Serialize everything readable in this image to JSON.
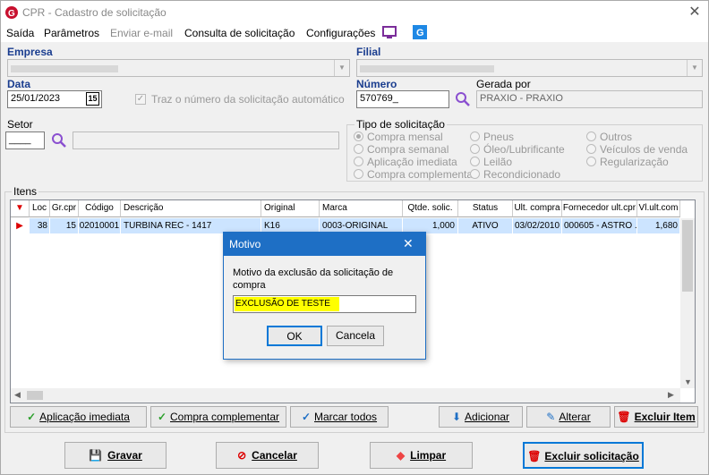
{
  "window": {
    "title": "CPR - Cadastro de solicitação",
    "close": "✕"
  },
  "menu": {
    "saida": "Saída",
    "parametros": "Parâmetros",
    "enviar": "Enviar e-mail",
    "consulta": "Consulta de solicitação",
    "configuracoes": "Configurações"
  },
  "form": {
    "empresa_label": "Empresa",
    "filial_label": "Filial",
    "data_label": "Data",
    "data_value": "25/01/2023",
    "cal_day": "15",
    "traz_label": "Traz o número da solicitação automático",
    "numero_label": "Número",
    "numero_value": "570769_",
    "gerada_label": "Gerada por",
    "gerada_value": "PRAXIO - PRAXIO",
    "setor_label": "Setor",
    "setor_value": "____"
  },
  "tipo": {
    "title": "Tipo de solicitação",
    "options": [
      "Compra mensal",
      "Compra semanal",
      "Aplicação imediata",
      "Compra complementar",
      "Pneus",
      "Óleo/Lubrificante",
      "Leilão",
      "Recondicionado",
      "Outros",
      "Veículos de venda",
      "Regularização"
    ]
  },
  "itens": {
    "title": "Itens",
    "columns": [
      "Loc",
      "Gr.cpr",
      "Código",
      "Descrição",
      "Original",
      "Marca",
      "Qtde. solic.",
      "Status",
      "Ult. compra",
      "Fornecedor ult.cpr",
      "Vl.ult.com"
    ],
    "row": [
      "38",
      "15",
      "02010001",
      "TURBINA REC - 1417",
      "K16",
      "0003-ORIGINAL",
      "1,000",
      "ATIVO",
      "03/02/2010",
      "000605 - ASTRO ...",
      "1,680"
    ]
  },
  "buttons": {
    "aplicacao": "Aplicação imediata",
    "complementar": "Compra complementar",
    "marcar": "Marcar todos",
    "adicionar": "Adicionar",
    "alterar": "Alterar",
    "excluir_item": "Excluir Item",
    "gravar": "Gravar",
    "cancelar": "Cancelar",
    "limpar": "Limpar",
    "excluir_sol": "Excluir solicitação"
  },
  "dialog": {
    "title": "Motivo",
    "close": "✕",
    "prompt": "Motivo da exclusão da solicitação de compra",
    "input_value": "EXCLUSÃO DE TESTE",
    "ok": "OK",
    "cancel": "Cancela"
  },
  "colors": {
    "accent": "#1e6fc5",
    "label_blue": "#1a3d8f",
    "highlight": "#ffff00",
    "row_selected": "#cce4ff"
  }
}
